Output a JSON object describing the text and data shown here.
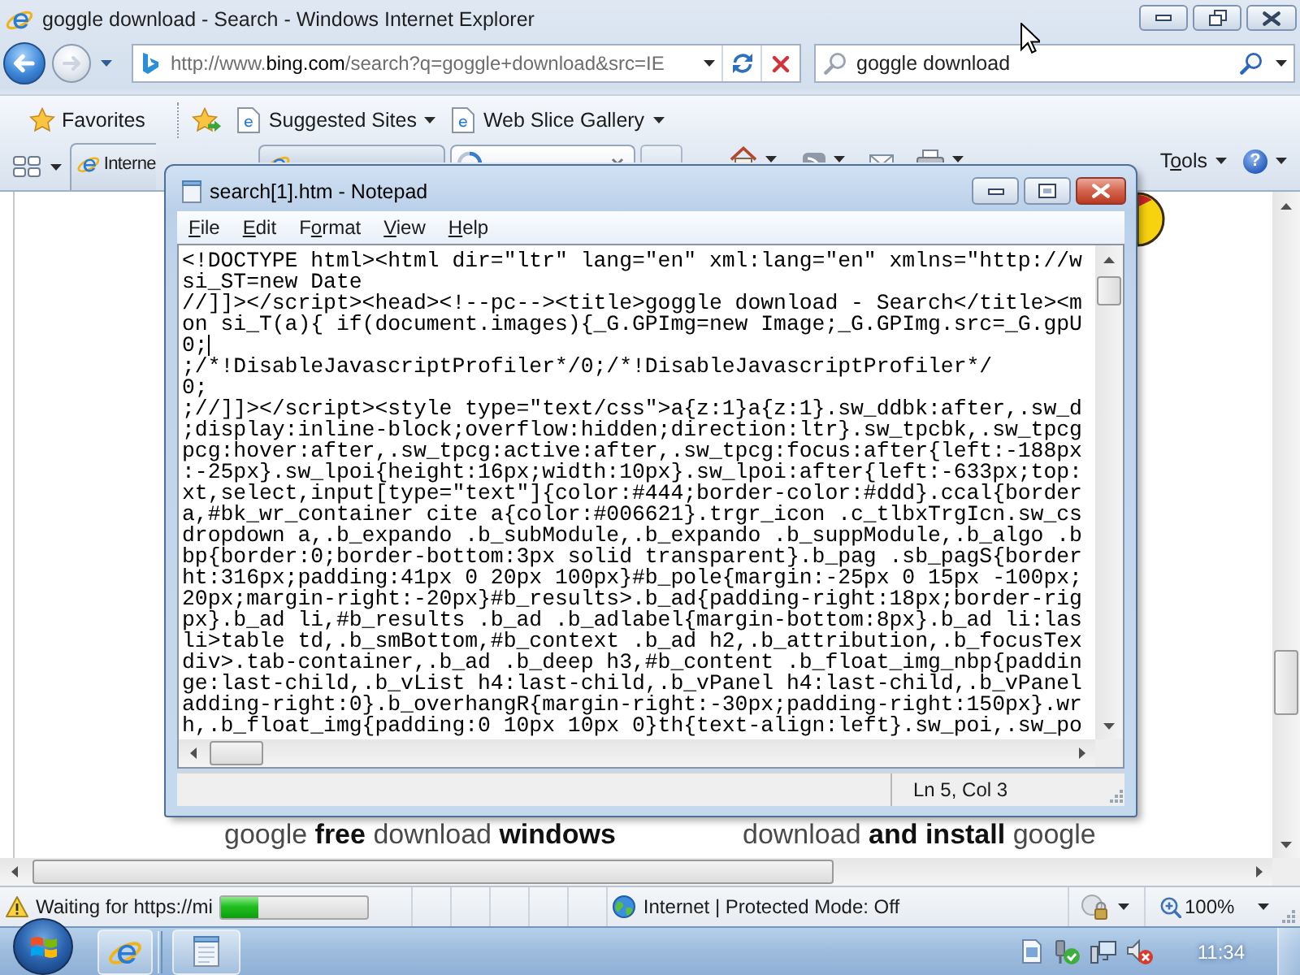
{
  "browser": {
    "title": "goggle download - Search - Windows Internet Explorer",
    "address": {
      "url_parts": [
        {
          "text": "http://www.",
          "highlighted": false
        },
        {
          "text": "bing.com",
          "highlighted": true
        },
        {
          "text": "/search?q=goggle+download&src=IE",
          "highlighted": false
        }
      ]
    },
    "search": {
      "value": "goggle download"
    },
    "favorites_bar": {
      "favorites": "Favorites",
      "links": [
        {
          "label": "Suggested Sites"
        },
        {
          "label": "Web Slice Gallery"
        }
      ]
    },
    "tabs": [
      {
        "label": "Interne",
        "selected": false,
        "loading": false
      },
      {
        "selected": false,
        "loading": false
      },
      {
        "selected": true,
        "loading": true
      }
    ],
    "command_bar": {
      "tools": {
        "lead": "T",
        "key": "o",
        "rest": "ols"
      },
      "help": "?"
    },
    "page": {
      "results": [
        "google **free** download **windows**",
        "download **and install** google"
      ]
    },
    "status_bar": {
      "message": "Waiting for https://mi",
      "progress": {
        "level": 0.26
      },
      "zone": "Internet | Protected Mode: Off",
      "zoom": "100%"
    }
  },
  "notepad": {
    "title": "search[1].htm - Notepad",
    "menu": [
      {
        "key": "F",
        "rest": "ile"
      },
      {
        "key": "E",
        "rest": "dit"
      },
      {
        "lead": "F",
        "key": "o",
        "rest": "rmat"
      },
      {
        "key": "V",
        "rest": "iew"
      },
      {
        "key": "H",
        "rest": "elp"
      }
    ],
    "lines": [
      {
        "text": "<!DOCTYPE html><html dir=\"ltr\" lang=\"en\" xml:lang=\"en\" xmlns=\"http://w",
        "caret": false
      },
      {
        "text": "si_ST=new Date",
        "caret": false
      },
      {
        "text": "//]]></script><head><!--pc--><title>goggle download - Search</title><m",
        "caret": false
      },
      {
        "text": "on si_T(a){ if(document.images){_G.GPImg=new Image;_G.GPImg.src=_G.gpU",
        "caret": false
      },
      {
        "text": "0;",
        "caret": true
      },
      {
        "text": ";/*!DisableJavascriptProfiler*/0;/*!DisableJavascriptProfiler*/",
        "caret": false
      },
      {
        "text": "0;",
        "caret": false
      },
      {
        "text": ";//]]></script><style type=\"text/css\">a{z:1}a{z:1}.sw_ddbk:after,.sw_d",
        "caret": false
      },
      {
        "text": ";display:inline-block;overflow:hidden;direction:ltr}.sw_tpcbk,.sw_tpcg",
        "caret": false
      },
      {
        "text": "pcg:hover:after,.sw_tpcg:active:after,.sw_tpcg:focus:after{left:-188px",
        "caret": false
      },
      {
        "text": ":-25px}.sw_lpoi{height:16px;width:10px}.sw_lpoi:after{left:-633px;top:",
        "caret": false
      },
      {
        "text": "xt,select,input[type=\"text\"]{color:#444;border-color:#ddd}.ccal{border",
        "caret": false
      },
      {
        "text": "a,#bk_wr_container cite a{color:#006621}.trgr_icon .c_tlbxTrgIcn.sw_cs",
        "caret": false
      },
      {
        "text": "dropdown a,.b_expando .b_subModule,.b_expando .b_suppModule,.b_algo .b",
        "caret": false
      },
      {
        "text": "bp{border:0;border-bottom:3px solid transparent}.b_pag .sb_pagS{border",
        "caret": false
      },
      {
        "text": "ht:316px;padding:41px 0 20px 100px}#b_pole{margin:-25px 0 15px -100px;",
        "caret": false
      },
      {
        "text": "20px;margin-right:-20px}#b_results>.b_ad{padding-right:18px;border-rig",
        "caret": false
      },
      {
        "text": "px}.b_ad li,#b_results .b_ad .b_adlabel{margin-bottom:8px}.b_ad li:las",
        "caret": false
      },
      {
        "text": "li>table td,.b_smBottom,#b_context .b_ad h2,.b_attribution,.b_focusTex",
        "caret": false
      },
      {
        "text": "div>.tab-container,.b_ad .b_deep h3,#b_content .b_float_img_nbp{paddin",
        "caret": false
      },
      {
        "text": "ge:last-child,.b_vList h4:last-child,.b_vPanel h4:last-child,.b_vPanel",
        "caret": false
      },
      {
        "text": "adding-right:0}.b_overhangR{margin-right:-30px;padding-right:150px}.wr",
        "caret": false
      },
      {
        "text": "h,.b_float_img{padding:0 10px 10px 0}th{text-align:left}.sw_poi,.sw_po",
        "caret": false
      }
    ],
    "status": "Ln 5, Col 3"
  },
  "taskbar": {
    "clock": "11:34"
  }
}
